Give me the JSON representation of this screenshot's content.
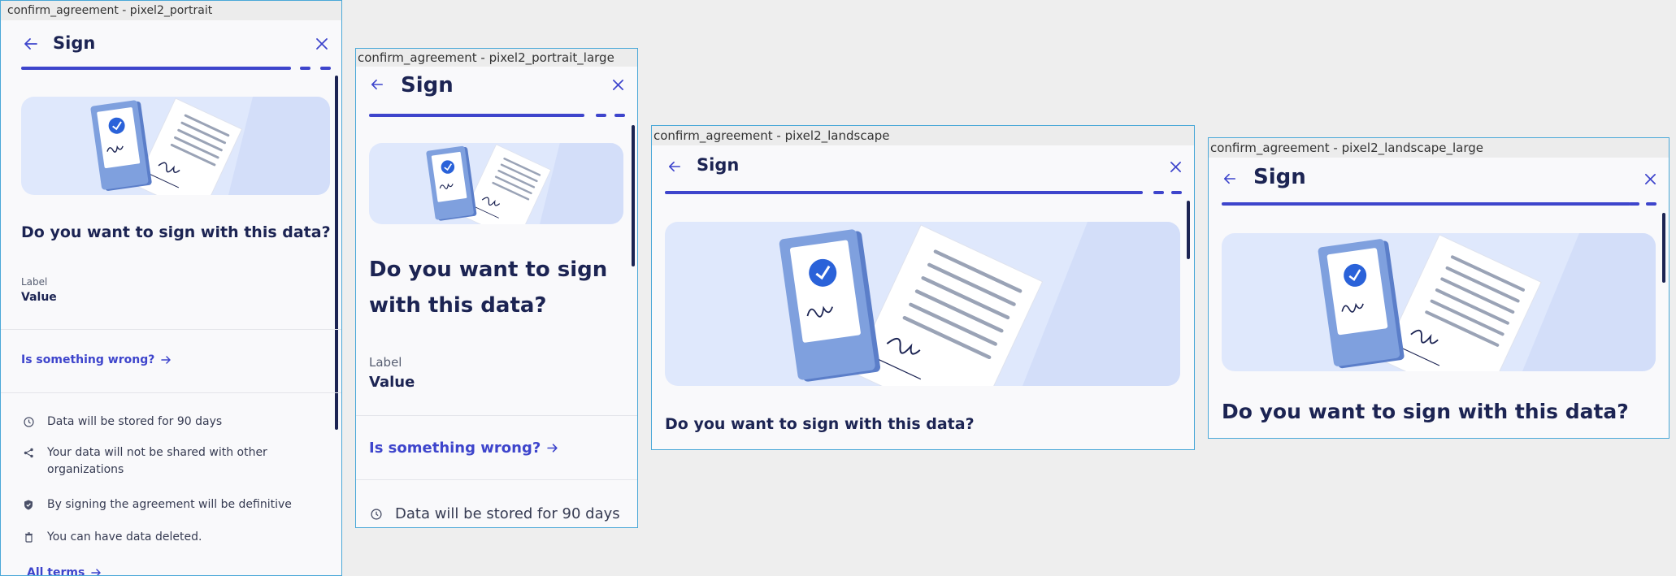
{
  "frames": [
    {
      "label": "confirm_agreement - pixel2_portrait",
      "title": "Sign",
      "question": "Do you want to sign with this data?",
      "field_label": "Label",
      "field_value": "Value",
      "wrong_link": "Is something wrong?",
      "info": [
        {
          "icon": "clock-icon",
          "text": "Data will be stored for 90 days"
        },
        {
          "icon": "share-icon",
          "text": "Your data will not be shared with other organizations"
        },
        {
          "icon": "shield-icon",
          "text": "By signing the agreement will be definitive"
        },
        {
          "icon": "trash-icon",
          "text": "You can have data deleted."
        }
      ],
      "all_terms": "All terms"
    },
    {
      "label": "confirm_agreement - pixel2_portrait_large",
      "title": "Sign",
      "question": "Do you want to sign with this data?",
      "field_label": "Label",
      "field_value": "Value",
      "wrong_link": "Is something wrong?",
      "info": [
        {
          "icon": "clock-icon",
          "text": "Data will be stored for 90 days"
        }
      ]
    },
    {
      "label": "confirm_agreement - pixel2_landscape",
      "title": "Sign",
      "question": "Do you want to sign with this data?"
    },
    {
      "label": "confirm_agreement - pixel2_landscape_large",
      "title": "Sign",
      "question": "Do you want to sign with this data?"
    }
  ],
  "colors": {
    "primary": "#3e45cc",
    "navy": "#1c2453",
    "hero_bg": "#dfe8fc",
    "frame_border": "#4aa8d8"
  }
}
